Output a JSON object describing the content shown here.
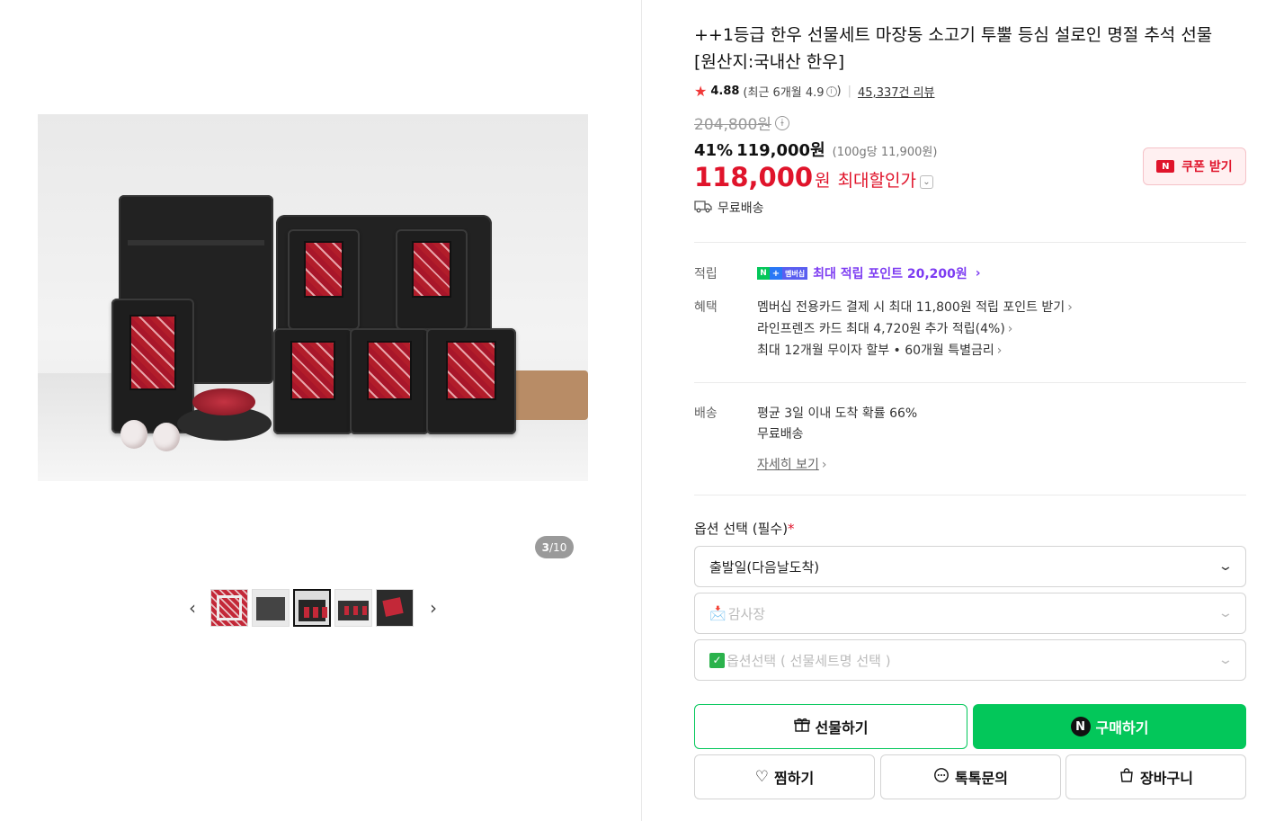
{
  "product": {
    "title": "++1등급 한우 선물세트 마장동 소고기 투뿔 등심 설로인 명절 추석 선물 [원산지:국내산 한우]",
    "rating": "4.88",
    "recent_rating": "(최근 6개월 4.9",
    "recent_rating_close": ")",
    "review_count": "45,337건 리뷰",
    "original_price": "204,800원",
    "discount_pct": "41%",
    "price": "119,000원",
    "unit_price": "(100g당 11,900원)",
    "max_price": "118,000",
    "max_won": "원",
    "max_label": "최대할인가",
    "coupon_label": "쿠폰 받기",
    "delivery": "무료배송"
  },
  "gallery": {
    "counter_current": "3",
    "counter_total": "/10",
    "selected_thumb_index": 3
  },
  "benefits": {
    "points_label": "적립",
    "membership_badge": "멤버십",
    "points_value": "최대 적립 포인트 20,200원",
    "benefit_label": "혜택",
    "benefit_items": [
      "멤버십 전용카드 결제 시 최대 11,800원 적립 포인트 받기",
      "라인프렌즈 카드 최대 4,720원 추가 적립(4%)",
      "최대 12개월 무이자 할부 • 60개월 특별금리"
    ],
    "shipping_label": "배송",
    "shipping_lines": [
      "평균 3일 이내 도착 확률 66%",
      "무료배송"
    ],
    "detail_link": "자세히 보기"
  },
  "options": {
    "label": "옵션 선택 (필수)",
    "required_mark": "*",
    "selects": [
      {
        "text": "출발일(다음날도착)"
      },
      {
        "text": "감사장"
      },
      {
        "text": "옵션선택 ( 선물세트명 선택 )"
      }
    ]
  },
  "actions": {
    "gift": "선물하기",
    "buy": "구매하기",
    "wish": "찜하기",
    "talk": "톡톡문의",
    "cart": "장바구니"
  },
  "colors": {
    "accent_green": "#03c75a",
    "price_red": "#e0142b",
    "membership_purple": "#7d3cf2"
  }
}
